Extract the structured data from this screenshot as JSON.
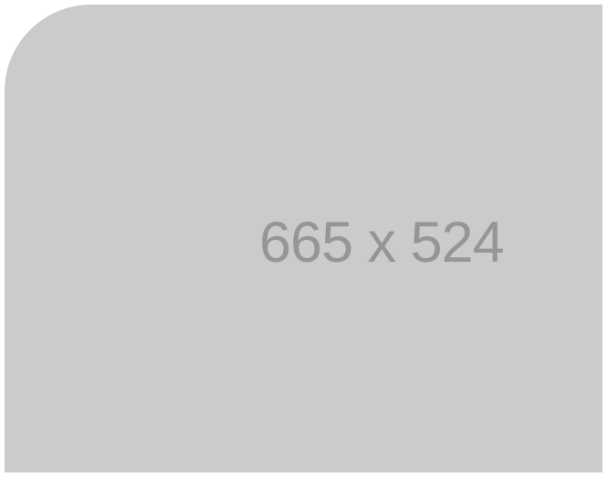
{
  "placeholder": {
    "label": "665 x 524",
    "background_color": "#cbcbcb",
    "text_color": "#969696"
  }
}
